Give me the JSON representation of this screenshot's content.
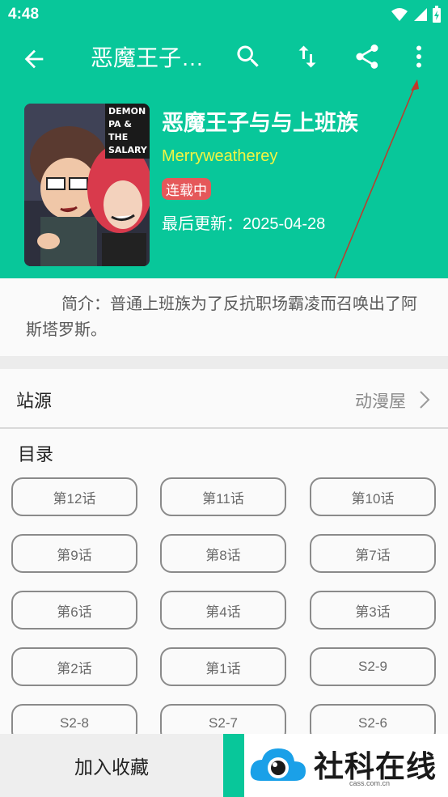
{
  "status_bar": {
    "time": "4:48"
  },
  "app_bar": {
    "title": "恶魔王子…",
    "icons": [
      "back-arrow-icon",
      "search-icon",
      "sort-icon",
      "share-icon",
      "more-vert-icon"
    ]
  },
  "comic": {
    "title": "恶魔王子与与上班族",
    "author": "Merryweatherey",
    "status": "连载中",
    "last_update": "最后更新：2025-04-28",
    "cover_text": "DEMON PA & THE SALARY",
    "description": "简介：普通上班族为了反抗职场霸凌而召唤出了阿斯塔罗斯。"
  },
  "source": {
    "label": "站源",
    "value": "动漫屋"
  },
  "toc": {
    "title": "目录",
    "chapters": [
      "第12话",
      "第11话",
      "第10话",
      "第9话",
      "第8话",
      "第7话",
      "第6话",
      "第4话",
      "第3话",
      "第2话",
      "第1话",
      "S2-9",
      "S2-8",
      "S2-7",
      "S2-6"
    ]
  },
  "bottom": {
    "favorite_label": "加入收藏"
  },
  "watermark": {
    "text": "社科在线",
    "sub": "cass.com.cn"
  },
  "colors": {
    "primary": "#08c79a",
    "author": "#f2f542",
    "badge": "#e5585a",
    "arrow": "#c0392b"
  }
}
